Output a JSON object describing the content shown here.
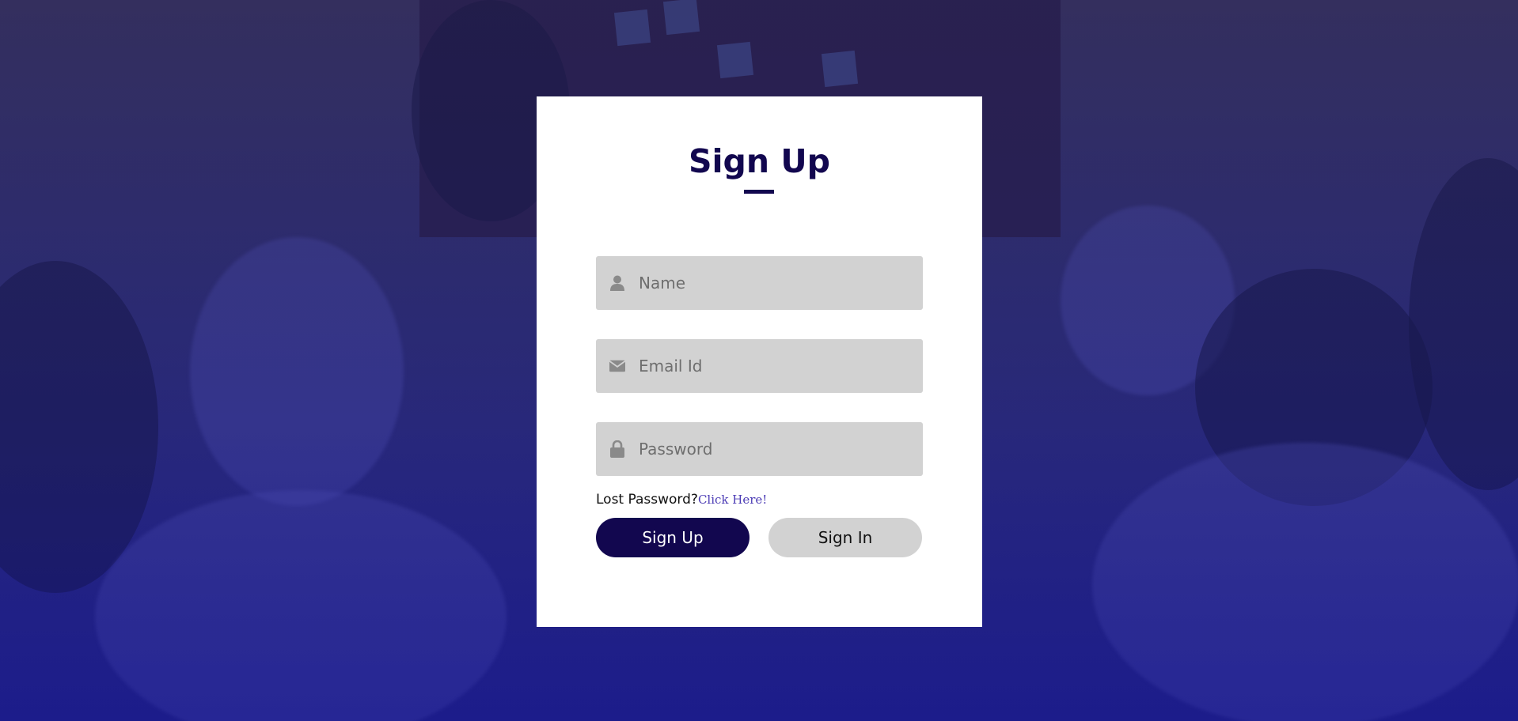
{
  "form": {
    "title": "Sign Up",
    "fields": {
      "name": {
        "placeholder": "Name",
        "icon": "user-icon"
      },
      "email": {
        "placeholder": "Email Id",
        "icon": "envelope-icon"
      },
      "password": {
        "placeholder": "Password",
        "icon": "lock-icon"
      }
    },
    "lost_password_text": "Lost Password?",
    "lost_password_link": "Click Here!",
    "buttons": {
      "primary": "Sign Up",
      "secondary": "Sign In"
    }
  },
  "colors": {
    "accent": "#12074f",
    "field_bg": "#d2d2d2",
    "link": "#4b3bb5"
  }
}
